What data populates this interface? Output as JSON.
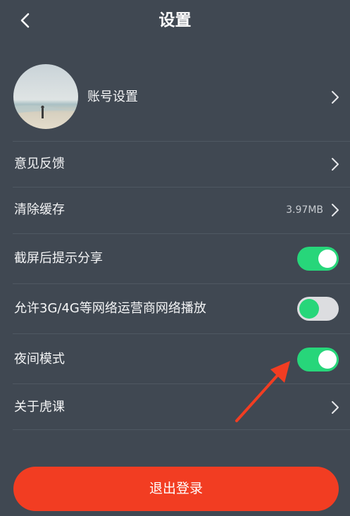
{
  "header": {
    "title": "设置",
    "back_icon": "chevron-left-icon"
  },
  "account": {
    "label": "账号设置",
    "avatar": "beach-photo-avatar"
  },
  "menu": {
    "feedback_label": "意见反馈",
    "clear_cache_label": "清除缓存",
    "cache_size": "3.97MB",
    "screenshot_share_label": "截屏后提示分享",
    "screenshot_share_on": true,
    "network_play_label": "允许3G/4G等网络运营商网络播放",
    "network_play_on": false,
    "night_mode_label": "夜间模式",
    "night_mode_on": true,
    "about_label": "关于虎课"
  },
  "logout_label": "退出登录",
  "colors": {
    "background": "#404852",
    "toggle_on": "#27d67a",
    "logout": "#f23d22",
    "annotation_arrow": "#f23d22"
  }
}
